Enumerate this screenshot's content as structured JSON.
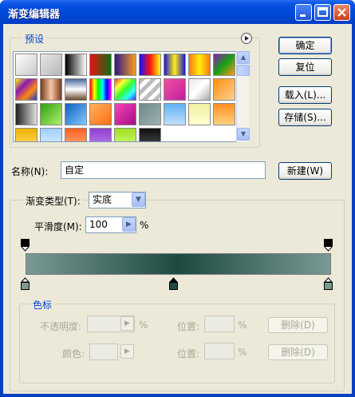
{
  "window": {
    "title": "渐变编辑器",
    "controls": [
      "minimize",
      "maximize",
      "close"
    ]
  },
  "presets": {
    "label": "预设",
    "menu_icon": "circle-arrow-right-icon",
    "swatches": [
      {
        "name": "foreground-to-background",
        "bg": "linear-gradient(135deg,#ffffff,#c8c8c8)"
      },
      {
        "name": "foreground-to-transparent",
        "bg": "linear-gradient(135deg,#e6e6e6,#b8b8b8)"
      },
      {
        "name": "black-white",
        "bg": "linear-gradient(90deg,#000000,#ffffff)"
      },
      {
        "name": "red-green",
        "bg": "linear-gradient(90deg,#e81010,#107010)"
      },
      {
        "name": "violet-orange",
        "bg": "linear-gradient(90deg,#2a1a8a,#ff9b1a)"
      },
      {
        "name": "blue-red-yellow",
        "bg": "linear-gradient(90deg,#1010ff,#ff1010,#ffff10)"
      },
      {
        "name": "blue-yellow-blue",
        "bg": "linear-gradient(90deg,#1a1ad0,#ffee10,#1a1ad0)"
      },
      {
        "name": "orange-yellow-orange",
        "bg": "linear-gradient(90deg,#ff7a10,#ffee10,#ff7a10)"
      },
      {
        "name": "violet-green-orange",
        "bg": "linear-gradient(135deg,#8a1ab0,#18a018,#ff9b1a)"
      },
      {
        "name": "yellow-violet-orange-blue",
        "bg": "linear-gradient(135deg,#ffee10,#8a1ab0,#ff8a10,#1a3ad0)"
      },
      {
        "name": "copper",
        "bg": "linear-gradient(90deg,#7a3a1a,#f5c8a8,#7a3a1a)"
      },
      {
        "name": "chrome",
        "bg": "linear-gradient(180deg,#4a6a9a,#ffffff 50%,#6a4a2a)"
      },
      {
        "name": "spectrum",
        "bg": "linear-gradient(90deg,#ff0000,#ffff00,#00ff00,#00ffff,#0000ff,#ff00ff)"
      },
      {
        "name": "transparent-rainbow",
        "bg": "linear-gradient(135deg,#ff3030,#ffff30,#30ff30,#30ffff,#3030ff)"
      },
      {
        "name": "transparent-stripes",
        "bg": "repeating-linear-gradient(135deg,#bdbdbd 0 5px,#ffffff 5px 10px)"
      },
      {
        "name": "pink-violet",
        "bg": "linear-gradient(135deg,#f050a0,#c020a0)"
      },
      {
        "name": "silver-1",
        "bg": "linear-gradient(135deg,#e8e8e8,#ffffff 50%,#a8a8a8)"
      },
      {
        "name": "orange-1",
        "bg": "linear-gradient(135deg,#ff9010,#ffd090)"
      },
      {
        "name": "gray-black",
        "bg": "linear-gradient(90deg,#202020,#e0e0e0)"
      },
      {
        "name": "green-1",
        "bg": "linear-gradient(135deg,#30a010,#b0f070)"
      },
      {
        "name": "blue-1",
        "bg": "linear-gradient(135deg,#1060c0,#80c8ff)"
      },
      {
        "name": "orange-2",
        "bg": "linear-gradient(135deg,#ffb060,#ff7010)"
      },
      {
        "name": "magenta-1",
        "bg": "linear-gradient(135deg,#ff40c0,#a01080)"
      },
      {
        "name": "teal-gray",
        "bg": "linear-gradient(135deg,#6a8a88,#a0b0b0)"
      },
      {
        "name": "light-blue",
        "bg": "linear-gradient(180deg,#60b0f0,#c0e0ff)"
      },
      {
        "name": "pale-yellow",
        "bg": "linear-gradient(180deg,#f0f0a0,#ffffd0)"
      },
      {
        "name": "orange-3",
        "bg": "linear-gradient(180deg,#ff9020,#ffd080)"
      },
      {
        "name": "gold",
        "bg": "linear-gradient(180deg,#f0b000,#ffe070)"
      },
      {
        "name": "sky",
        "bg": "linear-gradient(180deg,#a0d0ff,#e0f0ff)"
      },
      {
        "name": "orange-red",
        "bg": "linear-gradient(180deg,#ff6020,#ffb080)"
      },
      {
        "name": "purple",
        "bg": "linear-gradient(180deg,#9040d0,#c080f0)"
      },
      {
        "name": "lime",
        "bg": "linear-gradient(180deg,#a0e020,#d0ff80)"
      },
      {
        "name": "black-1",
        "bg": "linear-gradient(180deg,#101010,#505050)"
      }
    ]
  },
  "buttons": {
    "ok": "确定",
    "reset": "复位",
    "load": "载入(L)...",
    "save": "存储(S)...",
    "new": "新建(W)"
  },
  "name_field": {
    "label": "名称(N):",
    "value": "自定"
  },
  "gradient_type": {
    "label": "渐变类型(T):",
    "value": "实底"
  },
  "smoothness": {
    "label": "平滑度(M):",
    "value": "100",
    "unit": "%"
  },
  "gradient": {
    "stops": [
      {
        "position": 0,
        "color": "#7a9a94"
      },
      {
        "position": 50,
        "color": "#1c4a40"
      },
      {
        "position": 100,
        "color": "#7a9a94"
      }
    ],
    "opacity_stops": [
      0,
      100
    ],
    "selected_stop": 1
  },
  "color_stops_group": {
    "label": "色标",
    "opacity_label": "不透明度:",
    "opacity_unit": "%",
    "opacity_position_label": "位置:",
    "opacity_position_unit": "%",
    "opacity_delete": "删除(D)",
    "color_label": "颜色:",
    "color_position_label": "位置:",
    "color_position_unit": "%",
    "color_delete": "删除(D)"
  }
}
